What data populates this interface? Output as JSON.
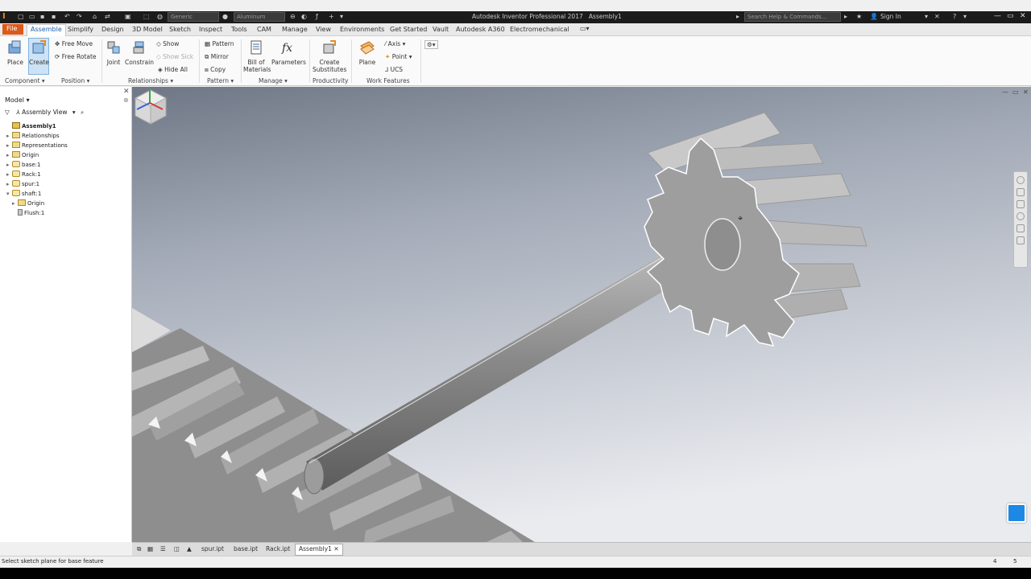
{
  "titlebar": {
    "app_title": "Autodesk Inventor Professional 2017",
    "doc_title": "Assembly1",
    "appearance_combo": "Generic",
    "material_combo": "Aluminum",
    "search_placeholder": "Search Help & Commands...",
    "signin_label": "Sign In"
  },
  "tabs": {
    "file": "File",
    "items": [
      "Assemble",
      "Simplify",
      "Design",
      "3D Model",
      "Sketch",
      "Inspect",
      "Tools",
      "CAM",
      "Manage",
      "View",
      "Environments",
      "Get Started",
      "Vault",
      "Autodesk A360",
      "Electromechanical"
    ]
  },
  "ribbon": {
    "place": "Place",
    "create": "Create",
    "free_move": "Free Move",
    "free_rotate": "Free Rotate",
    "joint": "Joint",
    "constrain": "Constrain",
    "show": "Show",
    "show_sick": "Show Sick",
    "hide_all": "Hide All",
    "pattern": "Pattern",
    "mirror": "Mirror",
    "copy": "Copy",
    "bill_of_materials_1": "Bill of",
    "bill_of_materials_2": "Materials",
    "parameters": "Parameters",
    "create_substitutes_1": "Create",
    "create_substitutes_2": "Substitutes",
    "plane": "Plane",
    "axis": "Axis",
    "point": "Point",
    "ucs": "UCS",
    "panels": {
      "component": "Component",
      "position": "Position",
      "relationships": "Relationships",
      "pattern": "Pattern",
      "manage": "Manage",
      "productivity": "Productivity",
      "work_features": "Work Features"
    }
  },
  "browser": {
    "header": "Model",
    "view_mode": "Assembly View",
    "tree": [
      {
        "label": "Assembly1",
        "kind": "asm",
        "bold": true
      },
      {
        "label": "Relationships",
        "kind": "folder"
      },
      {
        "label": "Representations",
        "kind": "folder"
      },
      {
        "label": "Origin",
        "kind": "folder"
      },
      {
        "label": "base:1",
        "kind": "part"
      },
      {
        "label": "Rack:1",
        "kind": "part"
      },
      {
        "label": "spur:1",
        "kind": "part"
      },
      {
        "label": "shaft:1",
        "kind": "part"
      },
      {
        "label": "Origin",
        "kind": "folder"
      },
      {
        "label": "Flush:1",
        "kind": "flush"
      }
    ]
  },
  "doctabs": [
    "spur.ipt",
    "base.ipt",
    "Rack.ipt",
    "Assembly1"
  ],
  "status": {
    "message": "Select sketch plane for base feature",
    "count_a": "4",
    "count_b": "5"
  },
  "colors": {
    "file_tab": "#d95a1a",
    "viewport_top": "#dfe3ea",
    "viewport_bottom": "#9aa2b2",
    "part_gray": "#a6a6a6"
  }
}
